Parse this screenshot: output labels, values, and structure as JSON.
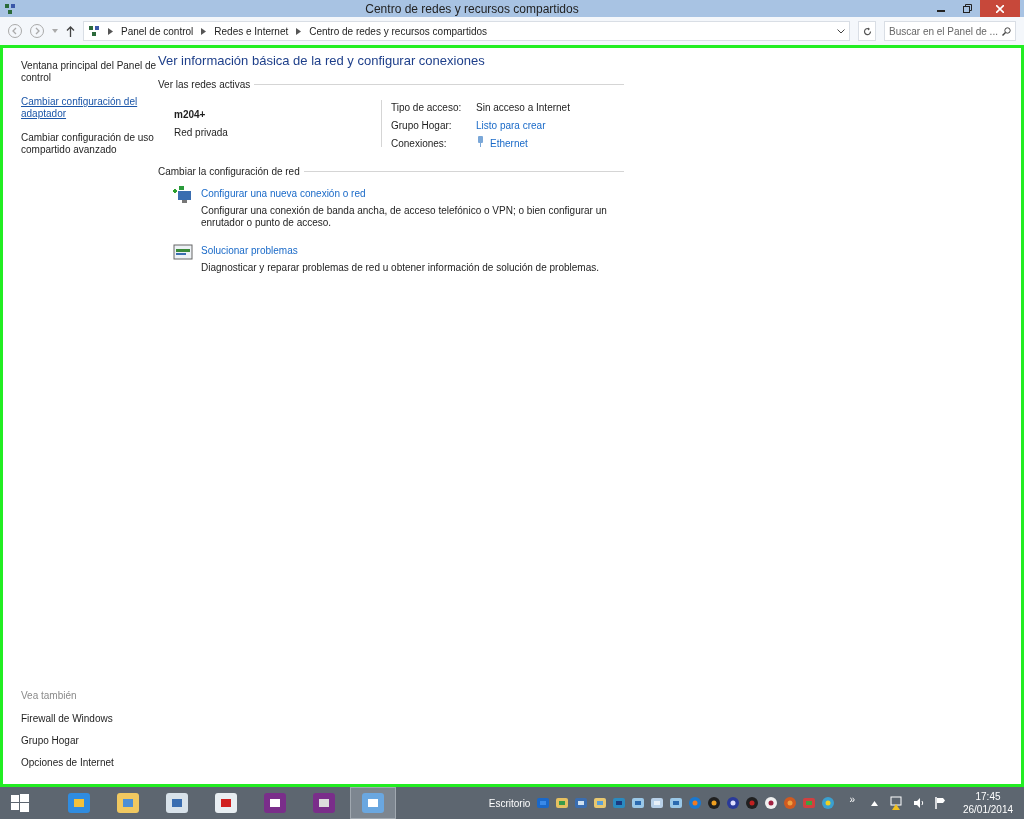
{
  "window": {
    "title": "Centro de redes y recursos compartidos"
  },
  "breadcrumb": [
    "Panel de control",
    "Redes e Internet",
    "Centro de redes y recursos compartidos"
  ],
  "search": {
    "placeholder": "Buscar en el Panel de ..."
  },
  "sidebar": {
    "links": [
      {
        "label": "Ventana principal del Panel de control",
        "kind": "plain"
      },
      {
        "label": "Cambiar configuración del adaptador",
        "kind": "link"
      },
      {
        "label": "Cambiar configuración de uso compartido avanzado",
        "kind": "plain"
      }
    ],
    "see_also": {
      "heading": "Vea también",
      "links": [
        "Firewall de Windows",
        "Grupo Hogar",
        "Opciones de Internet"
      ]
    }
  },
  "main": {
    "title": "Ver información básica de la red y configurar conexiones",
    "active_networks": {
      "heading": "Ver las redes activas",
      "name": "m204+",
      "type": "Red privada",
      "properties": [
        {
          "label": "Tipo de acceso:",
          "value": "Sin acceso a Internet",
          "kind": "text"
        },
        {
          "label": "Grupo Hogar:",
          "value": "Listo para crear",
          "kind": "link"
        },
        {
          "label": "Conexiones:",
          "value": "Ethernet",
          "kind": "connection"
        }
      ]
    },
    "change_settings": {
      "heading": "Cambiar la configuración de red",
      "tasks": [
        {
          "title": "Configurar una nueva conexión o red",
          "description": "Configurar una conexión de banda ancha, de acceso telefónico o VPN; o bien configurar un enrutador o punto de acceso.",
          "kind": "new-connection"
        },
        {
          "title": "Solucionar problemas",
          "description": "Diagnosticar y reparar problemas de red u obtener información de solución de problemas.",
          "kind": "troubleshoot"
        }
      ]
    }
  },
  "taskbar": {
    "toolbar": "Escritorio",
    "more": "»",
    "time": "17:45",
    "date": "26/01/2014"
  }
}
